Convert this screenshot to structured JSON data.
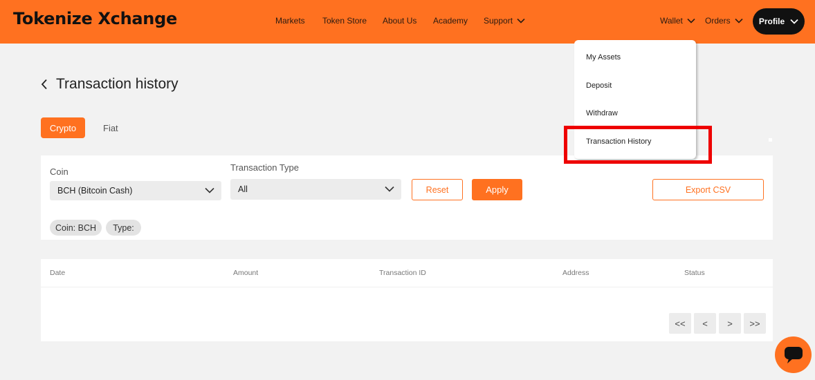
{
  "header": {
    "logo": "Tokenize Xchange",
    "nav": [
      "Markets",
      "Token Store",
      "About Us",
      "Academy"
    ],
    "support": "Support",
    "wallet": "Wallet",
    "orders": "Orders",
    "profile": "Profile"
  },
  "page": {
    "title": "Transaction history"
  },
  "tabs": {
    "crypto": "Crypto",
    "fiat": "Fiat"
  },
  "filters": {
    "coin_label": "Coin",
    "coin_value": "BCH (Bitcoin Cash)",
    "type_label": "Transaction Type",
    "type_value": "All",
    "reset": "Reset",
    "apply": "Apply",
    "export": "Export CSV",
    "chips": [
      "Coin: BCH",
      "Type:"
    ]
  },
  "table": {
    "columns": [
      "Date",
      "Amount",
      "Transaction ID",
      "Address",
      "Status"
    ],
    "pagination": [
      "<<",
      "<",
      ">",
      ">>"
    ]
  },
  "dropdown": {
    "items": [
      "My Assets",
      "Deposit",
      "Withdraw",
      "Transaction History"
    ]
  },
  "colors": {
    "brand": "#ff7120",
    "highlight": "#ee0000"
  },
  "icons": {
    "back": "chevron-left-icon",
    "chat": "chat-icon"
  }
}
